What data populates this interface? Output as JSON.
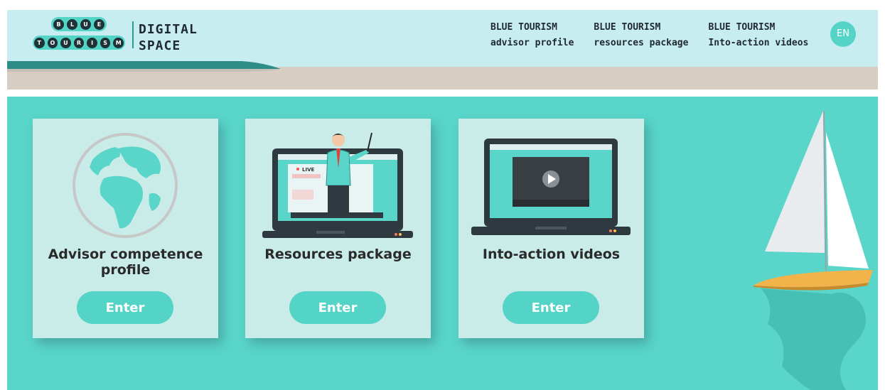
{
  "header": {
    "logo": {
      "row1": [
        "B",
        "L",
        "U",
        "E"
      ],
      "row2": [
        "T",
        "O",
        "U",
        "R",
        "I",
        "S",
        "M"
      ],
      "title": "DIGITAL\nSPACE"
    },
    "nav": [
      {
        "line1": "BLUE TOURISM",
        "line2": "advisor profile"
      },
      {
        "line1": "BLUE TOURISM",
        "line2": "resources package"
      },
      {
        "line1": "BLUE TOURISM",
        "line2": "Into-action videos"
      }
    ],
    "language": "EN"
  },
  "cards": [
    {
      "title": "Advisor competence profile",
      "button": "Enter",
      "illustration": "globe-icon"
    },
    {
      "title": "Resources package",
      "button": "Enter",
      "illustration": "live-presenter-laptop-icon",
      "badge": "LIVE"
    },
    {
      "title": "Into-action videos",
      "button": "Enter",
      "illustration": "video-player-laptop-icon"
    }
  ],
  "colors": {
    "header_bg": "#c8edf1",
    "sand": "#d7cdc3",
    "sea": "#59d5ca",
    "card_bg": "#c9ece9",
    "accent": "#54d4c7",
    "text_dark": "#1f2a30"
  }
}
